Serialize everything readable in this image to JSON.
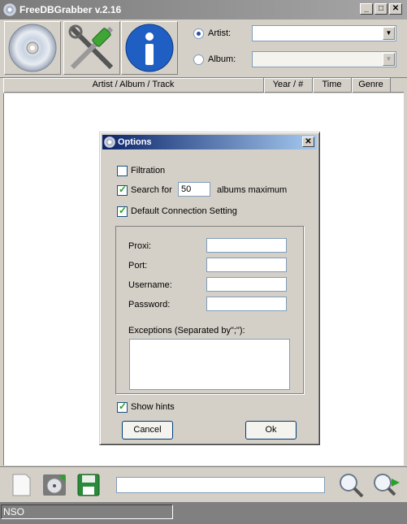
{
  "window": {
    "title": "FreeDBGrabber v.2.16",
    "controls": {
      "minimize": "_",
      "maximize": "□",
      "close": "✕"
    }
  },
  "toolbar": {
    "buttons": [
      {
        "icon": "cd-icon"
      },
      {
        "icon": "tools-icon"
      },
      {
        "icon": "info-icon"
      }
    ],
    "search": {
      "artist_label": "Artist:",
      "album_label": "Album:",
      "artist_value": "",
      "album_value": "",
      "selected": "artist"
    }
  },
  "list": {
    "columns": [
      "Artist / Album / Track",
      "Year / #",
      "Time",
      "Genre"
    ]
  },
  "dialog": {
    "title": "Options",
    "close": "✕",
    "filtration_label": "Filtration",
    "filtration_checked": false,
    "search_for_label": "Search for",
    "search_for_value": "50",
    "albums_max_label": "albums maximum",
    "search_for_checked": true,
    "default_conn_label": "Default Connection Setting",
    "default_conn_checked": true,
    "proxy_label": "Proxi:",
    "port_label": "Port:",
    "username_label": "Username:",
    "password_label": "Password:",
    "exceptions_label": "Exceptions (Separated by\";\"):",
    "show_hints_label": "Show hints",
    "show_hints_checked": true,
    "cancel_label": "Cancel",
    "ok_label": "Ok"
  },
  "bottom": {
    "input_value": ""
  },
  "status": {
    "text": "NSO"
  }
}
